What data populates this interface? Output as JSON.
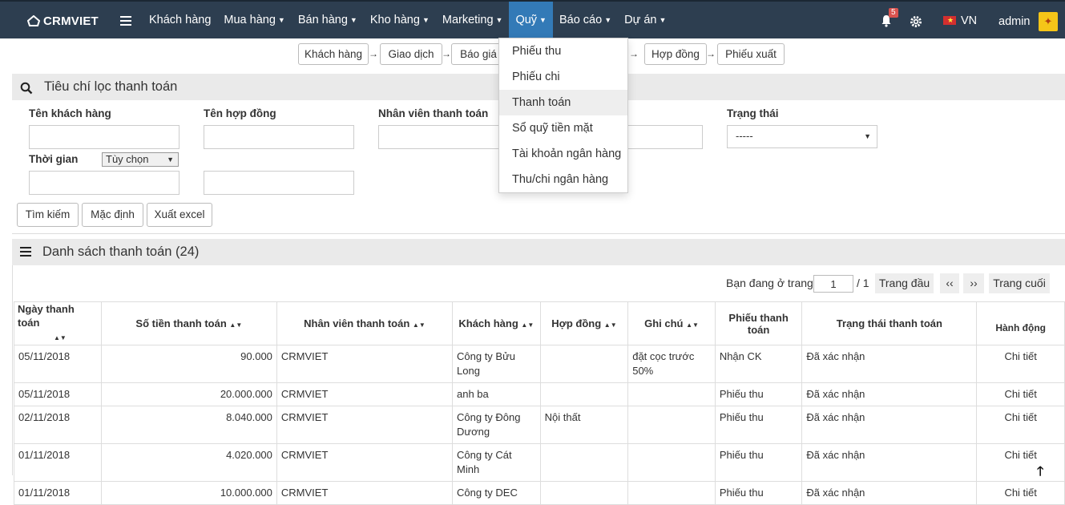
{
  "nav": {
    "logo": "CRMVIET",
    "menu": [
      {
        "label": "Khách hàng",
        "caret": false
      },
      {
        "label": "Mua hàng",
        "caret": true
      },
      {
        "label": "Bán hàng",
        "caret": true
      },
      {
        "label": "Kho hàng",
        "caret": true
      },
      {
        "label": "Marketing",
        "caret": true
      },
      {
        "label": "Quỹ",
        "caret": true,
        "active": true
      },
      {
        "label": "Báo cáo",
        "caret": true
      },
      {
        "label": "Dự án",
        "caret": true
      }
    ],
    "notification_count": "5",
    "language": "VN",
    "user": "admin"
  },
  "flow": {
    "steps": [
      "Khách hàng",
      "Giao dịch",
      "Báo giá",
      "Hợp đồng",
      "Phiếu xuất"
    ]
  },
  "dropdown": {
    "items": [
      "Phiếu thu",
      "Phiếu chi",
      "Thanh toán",
      "Sổ quỹ tiền mặt",
      "Tài khoản ngân hàng",
      "Thu/chi ngân hàng"
    ],
    "hovered": "Thanh toán"
  },
  "filter": {
    "title": "Tiêu chí lọc thanh toán",
    "customer_label": "Tên khách hàng",
    "contract_label": "Tên hợp đồng",
    "staff_label": "Nhân viên thanh toán",
    "status_label": "Trạng thái",
    "status_value": "-----",
    "time_label": "Thời gian",
    "time_option": "Tùy chọn",
    "buttons": {
      "search": "Tìm kiếm",
      "default": "Mặc định",
      "export": "Xuất excel"
    }
  },
  "list": {
    "title": "Danh sách thanh toán (24)",
    "pager": {
      "prefix": "Bạn đang ở trang",
      "page": "1",
      "total": "/ 1",
      "first": "Trang đầu",
      "prev": "‹‹",
      "next": "››",
      "last": "Trang cuối"
    },
    "columns": [
      "Ngày thanh toán",
      "Số tiền thanh toán",
      "Nhân viên thanh toán",
      "Khách hàng",
      "Hợp đồng",
      "Ghi chú",
      "Phiếu thanh toán",
      "Trạng thái thanh toán",
      "Hành động"
    ],
    "rows": [
      {
        "date": "05/11/2018",
        "amount": "90.000",
        "staff": "CRMVIET",
        "customer": "Công ty Bửu Long",
        "contract": "",
        "note": "đặt cọc trước 50%",
        "voucher": "Nhận CK",
        "status": "Đã xác nhận",
        "action": "Chi tiết"
      },
      {
        "date": "05/11/2018",
        "amount": "20.000.000",
        "staff": "CRMVIET",
        "customer": "anh ba",
        "contract": "",
        "note": "",
        "voucher": "Phiếu thu",
        "status": "Đã xác nhận",
        "action": "Chi tiết"
      },
      {
        "date": "02/11/2018",
        "amount": "8.040.000",
        "staff": "CRMVIET",
        "customer": "Công ty Đông Dương",
        "contract": "Nội thất",
        "note": "",
        "voucher": "Phiếu thu",
        "status": "Đã xác nhận",
        "action": "Chi tiết"
      },
      {
        "date": "01/11/2018",
        "amount": "4.020.000",
        "staff": "CRMVIET",
        "customer": "Công ty Cát Minh",
        "contract": "",
        "note": "",
        "voucher": "Phiếu thu",
        "status": "Đã xác nhận",
        "action": "Chi tiết"
      },
      {
        "date": "01/11/2018",
        "amount": "10.000.000",
        "staff": "CRMVIET",
        "customer": "Công ty DEC",
        "contract": "",
        "note": "",
        "voucher": "Phiếu thu",
        "status": "Đã xác nhận",
        "action": "Chi tiết"
      }
    ]
  },
  "colors": {
    "navbar": "#2d3e50",
    "active_menu": "#337ab7",
    "link": "#3a87c8",
    "panel_header": "#eaeaea"
  }
}
